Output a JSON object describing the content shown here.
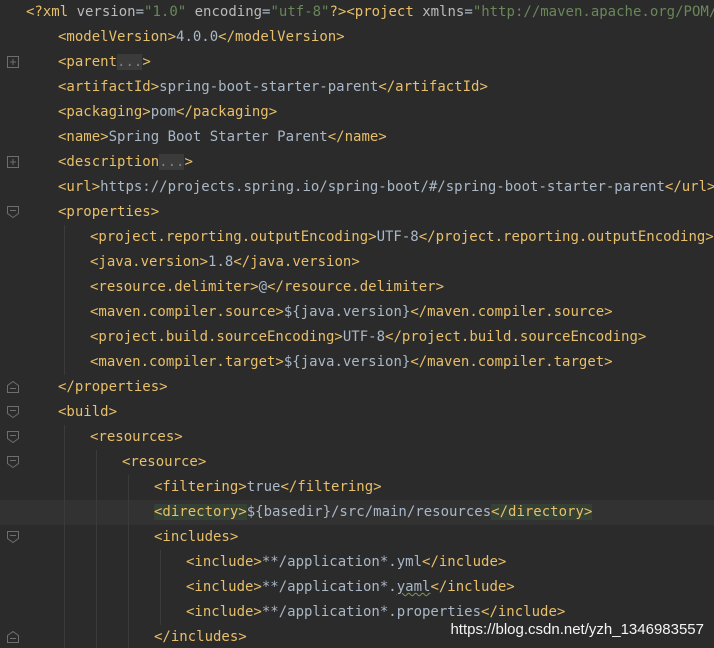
{
  "editor": {
    "lines": [
      {
        "indent": 0,
        "fold": "none",
        "parts": [
          {
            "c": "decl",
            "t": "<?xml "
          },
          {
            "c": "attr",
            "t": "version"
          },
          {
            "c": "text",
            "t": "="
          },
          {
            "c": "str",
            "t": "\"1.0\""
          },
          {
            "c": "attr",
            "t": " encoding"
          },
          {
            "c": "text",
            "t": "="
          },
          {
            "c": "str",
            "t": "\"utf-8\""
          },
          {
            "c": "decl",
            "t": "?>"
          },
          {
            "c": "tag",
            "t": "<project "
          },
          {
            "c": "attr",
            "t": "xmlns"
          },
          {
            "c": "text",
            "t": "="
          },
          {
            "c": "str",
            "t": "\"http://maven.apache.org/POM/4.0."
          }
        ]
      },
      {
        "indent": 1,
        "fold": "none",
        "parts": [
          {
            "c": "tag",
            "t": "<modelVersion>"
          },
          {
            "c": "text",
            "t": "4.0.0"
          },
          {
            "c": "tag",
            "t": "</modelVersion>"
          }
        ]
      },
      {
        "indent": 1,
        "fold": "plus",
        "parts": [
          {
            "c": "tag",
            "t": "<parent"
          },
          {
            "c": "dots",
            "t": "..."
          },
          {
            "c": "tag",
            "t": ">"
          }
        ]
      },
      {
        "indent": 1,
        "fold": "none",
        "parts": [
          {
            "c": "tag",
            "t": "<artifactId>"
          },
          {
            "c": "text",
            "t": "spring-boot-starter-parent"
          },
          {
            "c": "tag",
            "t": "</artifactId>"
          }
        ]
      },
      {
        "indent": 1,
        "fold": "none",
        "parts": [
          {
            "c": "tag",
            "t": "<packaging>"
          },
          {
            "c": "text",
            "t": "pom"
          },
          {
            "c": "tag",
            "t": "</packaging>"
          }
        ]
      },
      {
        "indent": 1,
        "fold": "none",
        "parts": [
          {
            "c": "tag",
            "t": "<name>"
          },
          {
            "c": "text",
            "t": "Spring Boot Starter Parent"
          },
          {
            "c": "tag",
            "t": "</name>"
          }
        ]
      },
      {
        "indent": 1,
        "fold": "plus",
        "parts": [
          {
            "c": "tag",
            "t": "<description"
          },
          {
            "c": "dots",
            "t": "..."
          },
          {
            "c": "tag",
            "t": ">"
          }
        ]
      },
      {
        "indent": 1,
        "fold": "none",
        "parts": [
          {
            "c": "tag",
            "t": "<url>"
          },
          {
            "c": "text",
            "t": "https://projects.spring.io/spring-boot/#/spring-boot-starter-parent"
          },
          {
            "c": "tag",
            "t": "</url>"
          }
        ]
      },
      {
        "indent": 1,
        "fold": "open",
        "parts": [
          {
            "c": "tag",
            "t": "<properties>"
          }
        ]
      },
      {
        "indent": 2,
        "fold": "none",
        "parts": [
          {
            "c": "tag",
            "t": "<project.reporting.outputEncoding>"
          },
          {
            "c": "text",
            "t": "UTF-8"
          },
          {
            "c": "tag",
            "t": "</project.reporting.outputEncoding>"
          }
        ]
      },
      {
        "indent": 2,
        "fold": "none",
        "parts": [
          {
            "c": "tag",
            "t": "<java.version>"
          },
          {
            "c": "text",
            "t": "1.8"
          },
          {
            "c": "tag",
            "t": "</java.version>"
          }
        ]
      },
      {
        "indent": 2,
        "fold": "none",
        "parts": [
          {
            "c": "tag",
            "t": "<resource.delimiter>"
          },
          {
            "c": "text",
            "t": "@"
          },
          {
            "c": "tag",
            "t": "</resource.delimiter>"
          }
        ]
      },
      {
        "indent": 2,
        "fold": "none",
        "parts": [
          {
            "c": "tag",
            "t": "<maven.compiler.source>"
          },
          {
            "c": "text",
            "t": "${java.version}"
          },
          {
            "c": "tag",
            "t": "</maven.compiler.source>"
          }
        ]
      },
      {
        "indent": 2,
        "fold": "none",
        "parts": [
          {
            "c": "tag",
            "t": "<project.build.sourceEncoding>"
          },
          {
            "c": "text",
            "t": "UTF-8"
          },
          {
            "c": "tag",
            "t": "</project.build.sourceEncoding>"
          }
        ]
      },
      {
        "indent": 2,
        "fold": "none",
        "parts": [
          {
            "c": "tag",
            "t": "<maven.compiler.target>"
          },
          {
            "c": "text",
            "t": "${java.version}"
          },
          {
            "c": "tag",
            "t": "</maven.compiler.target>"
          }
        ]
      },
      {
        "indent": 1,
        "fold": "close",
        "parts": [
          {
            "c": "tag",
            "t": "</properties>"
          }
        ]
      },
      {
        "indent": 1,
        "fold": "open",
        "parts": [
          {
            "c": "tag",
            "t": "<build>"
          }
        ]
      },
      {
        "indent": 2,
        "fold": "open",
        "parts": [
          {
            "c": "tag",
            "t": "<resources>"
          }
        ]
      },
      {
        "indent": 3,
        "fold": "open",
        "parts": [
          {
            "c": "tag",
            "t": "<resource>"
          }
        ]
      },
      {
        "indent": 4,
        "fold": "none",
        "parts": [
          {
            "c": "tag",
            "t": "<filtering>"
          },
          {
            "c": "text",
            "t": "true"
          },
          {
            "c": "tag",
            "t": "</filtering>"
          }
        ]
      },
      {
        "indent": 4,
        "fold": "none",
        "current": true,
        "parts": [
          {
            "c": "tag hl",
            "t": "<directory>"
          },
          {
            "c": "text",
            "t": "${basedir}/src/main/resources"
          },
          {
            "c": "tag hl",
            "t": "</directory>"
          }
        ]
      },
      {
        "indent": 4,
        "fold": "open",
        "parts": [
          {
            "c": "tag",
            "t": "<includes>"
          }
        ]
      },
      {
        "indent": 5,
        "fold": "none",
        "parts": [
          {
            "c": "tag",
            "t": "<include>"
          },
          {
            "c": "text",
            "t": "**/application*.yml"
          },
          {
            "c": "tag",
            "t": "</include>"
          }
        ]
      },
      {
        "indent": 5,
        "fold": "none",
        "parts": [
          {
            "c": "tag",
            "t": "<include>"
          },
          {
            "c": "text",
            "t": "**/application*."
          },
          {
            "c": "text typo",
            "t": "yaml"
          },
          {
            "c": "tag",
            "t": "</include>"
          }
        ]
      },
      {
        "indent": 5,
        "fold": "none",
        "parts": [
          {
            "c": "tag",
            "t": "<include>"
          },
          {
            "c": "text",
            "t": "**/application*.properties"
          },
          {
            "c": "tag",
            "t": "</include>"
          }
        ]
      },
      {
        "indent": 4,
        "fold": "close",
        "parts": [
          {
            "c": "tag",
            "t": "</includes>"
          }
        ]
      }
    ]
  },
  "watermark": "https://blog.csdn.net/yzh_1346983557",
  "colors": {
    "background": "#2b2b2b",
    "tag": "#e8bf6a",
    "string": "#6a8759",
    "text": "#a9b7c6",
    "attribute": "#bababa"
  }
}
